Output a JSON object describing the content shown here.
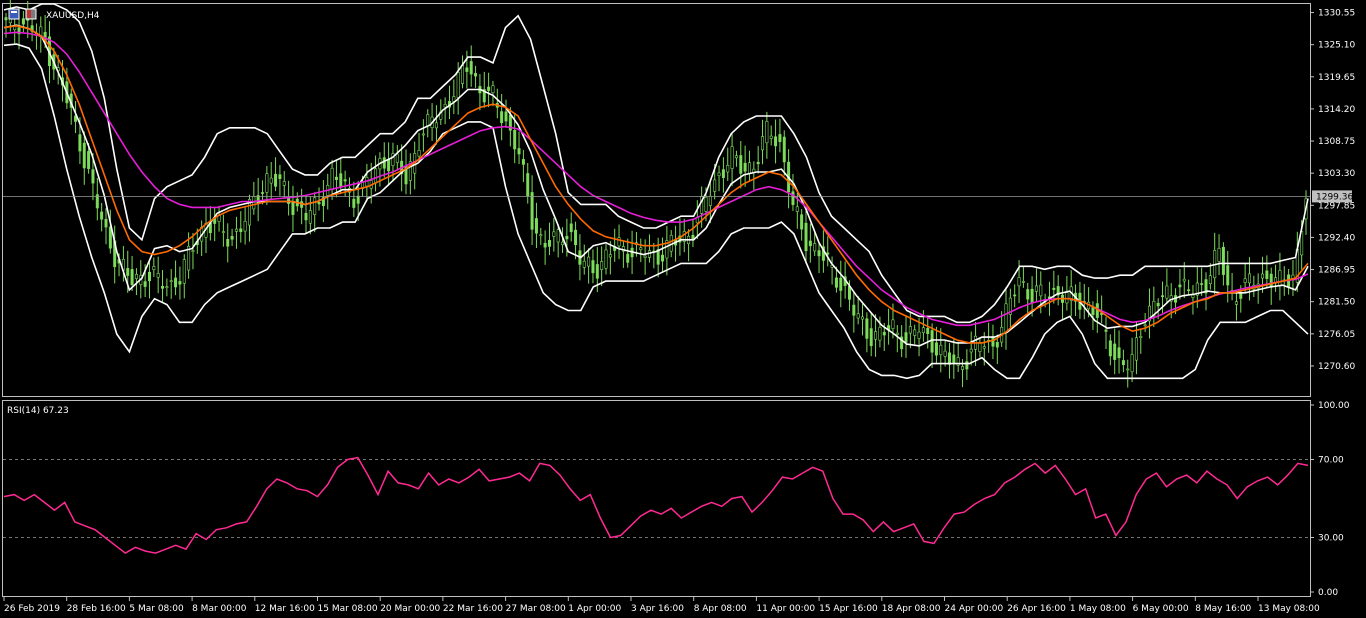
{
  "window": {
    "symbol_title": "XAUUSD,H4",
    "rsi_title": "RSI(14) 67.23",
    "current_price_tag": "1299.36"
  },
  "colors": {
    "background": "#000000",
    "frame": "#c0c0c0",
    "candle": "#7ddc5a",
    "bollinger": "#ffffff",
    "ma_fast": "#ff6a00",
    "ma_slow": "#e61ed8",
    "rsi_line": "#ff2a92",
    "price_tag_bg": "#bfbfbf"
  },
  "chart_data": [
    {
      "type": "line",
      "title": "XAUUSD,H4",
      "price_axis_ticks": [
        "1330.55",
        "1325.10",
        "1319.65",
        "1314.20",
        "1308.75",
        "1303.30",
        "1297.85",
        "1292.40",
        "1286.95",
        "1281.50",
        "1276.05",
        "1270.60"
      ],
      "ylim": [
        1265.5,
        1332.0
      ],
      "time_axis_ticks": [
        "26 Feb 2019",
        "28 Feb 16:00",
        "5 Mar 08:00",
        "8 Mar 00:00",
        "12 Mar 16:00",
        "15 Mar 08:00",
        "20 Mar 00:00",
        "22 Mar 16:00",
        "27 Mar 08:00",
        "1 Apr 00:00",
        "3 Apr 16:00",
        "8 Apr 08:00",
        "11 Apr 00:00",
        "15 Apr 16:00",
        "18 Apr 08:00",
        "24 Apr 00:00",
        "26 Apr 16:00",
        "1 May 08:00",
        "6 May 00:00",
        "8 May 16:00",
        "13 May 08:00"
      ],
      "current_price": 1299.36,
      "series": [
        {
          "values": [
            1328.5,
            1329.0,
            1328.0,
            1326.0,
            1321.0,
            1315.0,
            1308.0,
            1300.0,
            1293.0,
            1288.0,
            1285.0,
            1286.0,
            1285.5,
            1284.0,
            1286.0,
            1291.0,
            1295.0,
            1294.0,
            1292.0,
            1295.0,
            1299.0,
            1303.0,
            1301.0,
            1298.0,
            1296.0,
            1298.0,
            1303.0,
            1301.0,
            1299.0,
            1302.0,
            1305.0,
            1306.0,
            1302.0,
            1309.0,
            1312.0,
            1314.0,
            1318.0,
            1322.0,
            1317.0,
            1316.0,
            1312.0,
            1307.0,
            1296.0,
            1291.0,
            1292.0,
            1294.0,
            1288.0,
            1287.0,
            1289.0,
            1291.0,
            1290.0,
            1290.0,
            1289.0,
            1291.0,
            1292.0,
            1294.0,
            1299.0,
            1303.0,
            1306.0,
            1304.0,
            1305.0,
            1311.0,
            1308.0,
            1297.0,
            1292.0,
            1290.0,
            1287.0,
            1284.0,
            1279.0,
            1276.0,
            1276.0,
            1277.0,
            1275.0,
            1277.0,
            1275.0,
            1272.0,
            1271.0,
            1272.0,
            1275.0,
            1274.0,
            1279.0,
            1286.0,
            1282.0,
            1283.0,
            1283.0,
            1282.0,
            1282.0,
            1280.0,
            1276.0,
            1271.0,
            1270.5,
            1279.0,
            1281.0,
            1283.0,
            1284.0,
            1283.0,
            1285.0,
            1290.0,
            1282.0,
            1284.0,
            1285.0,
            1286.0,
            1284.5,
            1286.0,
            1299.4
          ]
        },
        {
          "values": [
            1328.0,
            1328.3,
            1327.8,
            1326.5,
            1324.0,
            1320.0,
            1315.0,
            1309.0,
            1303.0,
            1297.0,
            1292.0,
            1290.0,
            1289.5,
            1290.0,
            1291.0,
            1292.5,
            1294.5,
            1296.0,
            1297.0,
            1297.5,
            1298.0,
            1298.5,
            1298.5,
            1298.5,
            1298.0,
            1298.5,
            1299.5,
            1300.0,
            1300.5,
            1301.0,
            1302.0,
            1303.0,
            1304.0,
            1305.5,
            1307.5,
            1309.5,
            1311.5,
            1313.5,
            1314.5,
            1315.0,
            1314.5,
            1313.0,
            1309.0,
            1305.0,
            1301.0,
            1298.0,
            1295.5,
            1293.5,
            1292.5,
            1292.0,
            1291.5,
            1291.0,
            1291.0,
            1291.5,
            1292.5,
            1294.0,
            1296.0,
            1298.0,
            1300.0,
            1301.5,
            1302.5,
            1303.5,
            1303.0,
            1301.0,
            1298.0,
            1295.0,
            1292.0,
            1289.0,
            1286.0,
            1283.5,
            1281.5,
            1280.0,
            1279.0,
            1278.0,
            1277.0,
            1276.0,
            1275.0,
            1274.5,
            1274.5,
            1275.0,
            1276.5,
            1278.5,
            1280.0,
            1281.0,
            1282.0,
            1282.0,
            1281.5,
            1280.5,
            1279.0,
            1277.5,
            1276.5,
            1277.0,
            1278.0,
            1279.5,
            1280.5,
            1281.5,
            1282.0,
            1283.0,
            1283.0,
            1283.5,
            1284.0,
            1284.5,
            1285.0,
            1285.5,
            1288.0
          ]
        },
        {
          "values": [
            1327.0,
            1327.2,
            1327.0,
            1326.5,
            1325.5,
            1323.5,
            1320.5,
            1317.0,
            1313.5,
            1310.0,
            1306.5,
            1303.5,
            1301.0,
            1299.0,
            1298.0,
            1297.5,
            1297.5,
            1297.5,
            1298.0,
            1298.5,
            1298.5,
            1298.8,
            1299.0,
            1299.2,
            1299.5,
            1300.0,
            1300.5,
            1301.0,
            1301.5,
            1302.0,
            1302.8,
            1303.5,
            1304.5,
            1305.5,
            1306.5,
            1307.5,
            1308.5,
            1309.5,
            1310.5,
            1311.0,
            1311.2,
            1310.8,
            1309.0,
            1307.0,
            1305.0,
            1303.0,
            1301.0,
            1299.5,
            1298.5,
            1297.5,
            1296.5,
            1295.8,
            1295.3,
            1295.0,
            1295.0,
            1295.5,
            1296.5,
            1297.5,
            1298.5,
            1299.5,
            1300.5,
            1301.0,
            1300.5,
            1299.5,
            1297.5,
            1295.0,
            1292.5,
            1290.0,
            1287.5,
            1285.5,
            1283.5,
            1282.0,
            1280.5,
            1279.5,
            1278.5,
            1278.0,
            1277.5,
            1277.5,
            1278.0,
            1278.5,
            1279.5,
            1280.5,
            1281.3,
            1281.8,
            1282.0,
            1282.0,
            1281.5,
            1280.5,
            1279.5,
            1278.5,
            1278.0,
            1278.3,
            1279.0,
            1280.0,
            1280.8,
            1281.5,
            1282.2,
            1282.8,
            1283.3,
            1283.8,
            1284.2,
            1284.6,
            1285.0,
            1285.3,
            1286.2
          ]
        },
        {
          "values": [
            1331.0,
            1331.5,
            1331.0,
            1332.0,
            1332.0,
            1331.0,
            1329.0,
            1324.0,
            1316.0,
            1304.0,
            1294.0,
            1292.0,
            1299.0,
            1301.0,
            1302.0,
            1303.0,
            1306.0,
            1310.0,
            1311.0,
            1311.0,
            1311.0,
            1310.0,
            1307.0,
            1304.0,
            1303.0,
            1303.0,
            1305.0,
            1306.0,
            1306.0,
            1308.0,
            1310.0,
            1310.0,
            1312.0,
            1316.0,
            1316.0,
            1318.0,
            1320.0,
            1323.0,
            1323.0,
            1322.0,
            1328.0,
            1330.0,
            1326.0,
            1318.0,
            1310.0,
            1300.0,
            1298.0,
            1298.0,
            1298.0,
            1296.0,
            1295.0,
            1294.0,
            1294.0,
            1295.0,
            1296.0,
            1296.0,
            1300.0,
            1306.0,
            1310.0,
            1312.0,
            1313.0,
            1313.0,
            1313.0,
            1310.0,
            1306.0,
            1300.0,
            1296.0,
            1294.0,
            1292.0,
            1290.0,
            1286.0,
            1283.0,
            1280.0,
            1279.0,
            1279.0,
            1279.0,
            1278.0,
            1278.0,
            1279.0,
            1281.0,
            1284.0,
            1287.5,
            1287.5,
            1287.0,
            1287.5,
            1287.5,
            1286.0,
            1285.5,
            1285.5,
            1286.0,
            1286.0,
            1287.5,
            1287.5,
            1287.5,
            1287.5,
            1287.5,
            1287.5,
            1288.0,
            1288.0,
            1288.0,
            1288.0,
            1288.0,
            1288.5,
            1289.0,
            1299.0
          ]
        },
        {
          "values": [
            1325.0,
            1325.2,
            1324.5,
            1321.0,
            1313.0,
            1304.0,
            1296.0,
            1289.0,
            1283.0,
            1276.0,
            1273.0,
            1279.0,
            1282.0,
            1281.0,
            1278.0,
            1278.0,
            1281.0,
            1283.0,
            1284.0,
            1285.0,
            1286.0,
            1287.0,
            1290.0,
            1293.0,
            1293.0,
            1294.0,
            1294.0,
            1295.0,
            1295.0,
            1299.0,
            1300.0,
            1302.0,
            1304.0,
            1305.0,
            1307.0,
            1310.0,
            1311.0,
            1312.0,
            1312.0,
            1311.0,
            1301.0,
            1293.0,
            1288.0,
            1283.0,
            1281.0,
            1280.0,
            1280.0,
            1284.0,
            1285.0,
            1285.0,
            1285.0,
            1285.0,
            1286.0,
            1287.0,
            1288.0,
            1288.0,
            1288.0,
            1290.0,
            1293.0,
            1294.0,
            1294.0,
            1294.0,
            1295.0,
            1293.0,
            1288.0,
            1283.0,
            1280.0,
            1277.0,
            1273.0,
            1270.0,
            1269.0,
            1269.0,
            1268.5,
            1269.0,
            1271.0,
            1271.0,
            1271.0,
            1271.0,
            1272.0,
            1270.0,
            1268.5,
            1268.5,
            1272.0,
            1276.0,
            1278.0,
            1279.0,
            1276.0,
            1271.0,
            1268.5,
            1268.5,
            1268.5,
            1268.5,
            1268.5,
            1268.5,
            1268.5,
            1270.0,
            1275.0,
            1278.0,
            1278.0,
            1278.0,
            1279.0,
            1280.0,
            1280.0,
            1278.0,
            1276.0
          ]
        },
        {
          "values": [
            1328.0,
            1328.4,
            1327.8,
            1326.5,
            1322.0,
            1317.0,
            1312.0,
            1306.5,
            1299.5,
            1290.0,
            1283.5,
            1285.5,
            1290.5,
            1291.0,
            1290.0,
            1290.5,
            1293.5,
            1296.5,
            1297.5,
            1298.0,
            1298.5,
            1298.5,
            1298.5,
            1298.5,
            1298.0,
            1298.5,
            1299.5,
            1300.5,
            1300.5,
            1303.5,
            1305.0,
            1306.0,
            1308.0,
            1310.5,
            1311.5,
            1314.0,
            1315.5,
            1317.5,
            1317.5,
            1316.5,
            1314.5,
            1311.5,
            1307.0,
            1300.5,
            1295.5,
            1290.0,
            1289.0,
            1291.0,
            1291.5,
            1290.5,
            1290.0,
            1289.5,
            1290.0,
            1291.0,
            1292.0,
            1292.0,
            1294.0,
            1298.0,
            1301.5,
            1303.0,
            1303.5,
            1303.5,
            1304.0,
            1301.5,
            1297.0,
            1291.5,
            1288.0,
            1285.5,
            1282.5,
            1280.0,
            1277.5,
            1276.0,
            1274.3,
            1274.0,
            1275.0,
            1275.0,
            1274.5,
            1274.5,
            1275.5,
            1275.5,
            1276.3,
            1278.0,
            1279.8,
            1281.5,
            1282.8,
            1283.3,
            1281.0,
            1278.3,
            1277.0,
            1277.3,
            1277.3,
            1278.0,
            1279.8,
            1281.8,
            1282.5,
            1282.8,
            1283.3,
            1283.0,
            1283.0,
            1283.0,
            1283.5,
            1284.0,
            1284.3,
            1283.5,
            1287.5
          ]
        }
      ]
    },
    {
      "type": "line",
      "title": "RSI(14) 67.23",
      "y_axis_ticks": [
        "100.00",
        "70.00",
        "30.00",
        "0.00"
      ],
      "ylim": [
        0,
        100
      ],
      "levels": [
        70,
        30
      ],
      "series": [
        {
          "values": [
            51,
            52,
            49,
            52,
            48,
            44,
            48,
            38,
            36,
            34,
            30,
            26,
            22,
            25,
            23,
            22,
            24,
            26,
            24,
            32,
            29,
            34,
            35,
            37,
            38,
            46,
            55,
            60,
            58,
            55,
            54,
            51,
            57,
            66,
            70,
            71,
            62,
            52,
            64,
            58,
            57,
            55,
            63,
            57,
            60,
            58,
            61,
            65,
            59,
            60,
            61,
            63,
            59,
            68,
            67,
            62,
            55,
            49,
            52,
            40,
            30,
            31,
            36,
            41,
            44,
            42,
            45,
            40,
            43,
            46,
            48,
            46,
            50,
            51,
            43,
            48,
            54,
            61,
            60,
            63,
            66,
            64,
            50,
            42,
            42,
            39,
            33,
            38,
            33,
            35,
            37,
            28,
            27,
            35,
            42,
            43,
            47,
            50,
            52,
            58,
            61,
            65,
            68,
            63,
            67,
            60,
            52,
            55,
            40,
            42,
            31,
            38,
            52,
            60,
            63,
            56,
            60,
            62,
            58,
            64,
            60,
            57,
            50,
            56,
            59,
            61,
            57,
            62,
            68,
            67
          ]
        }
      ]
    }
  ]
}
